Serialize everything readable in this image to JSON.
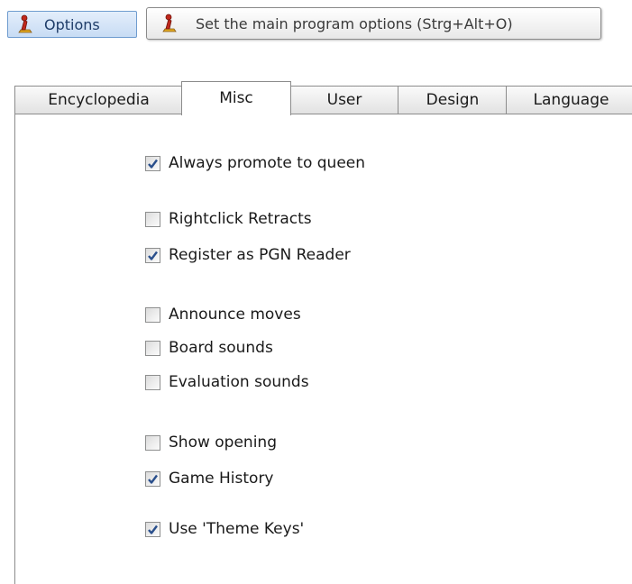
{
  "toolbar": {
    "options_label": "Options",
    "tooltip_text": "Set the main program options (Strg+Alt+O)",
    "icon": "chess-piece-icon"
  },
  "tabs": [
    {
      "label": "Encyclopedia",
      "active": false
    },
    {
      "label": "Misc",
      "active": true
    },
    {
      "label": "User",
      "active": false
    },
    {
      "label": "Design",
      "active": false
    },
    {
      "label": "Language",
      "active": false
    }
  ],
  "misc": {
    "options": [
      {
        "label": "Always promote to queen",
        "checked": true
      },
      {
        "label": "Rightclick Retracts",
        "checked": false
      },
      {
        "label": "Register as PGN Reader",
        "checked": true
      },
      {
        "label": "Announce moves",
        "checked": false
      },
      {
        "label": "Board sounds",
        "checked": false
      },
      {
        "label": "Evaluation sounds",
        "checked": false
      },
      {
        "label": "Show opening",
        "checked": false
      },
      {
        "label": "Game History",
        "checked": true
      },
      {
        "label": "Use 'Theme Keys'",
        "checked": true
      }
    ]
  },
  "colors": {
    "checkmark": "#2a4f8c",
    "icon_red": "#c0281c",
    "icon_gold": "#e0a820"
  }
}
